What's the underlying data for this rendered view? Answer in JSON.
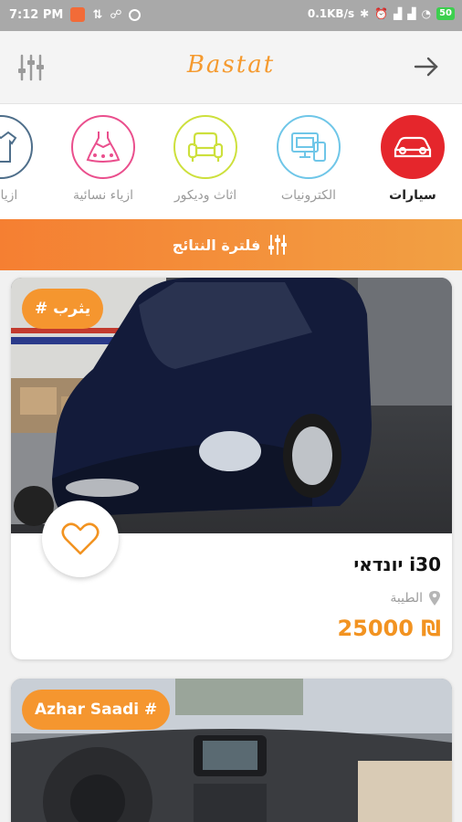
{
  "status_bar": {
    "time": "7:12 PM",
    "speed": "0.1KB/s",
    "battery": "50"
  },
  "app_bar": {
    "logo": "Bastat"
  },
  "categories": [
    {
      "label": "سيارات",
      "icon": "car-icon",
      "color": "#e5262c",
      "active": true
    },
    {
      "label": "الكترونيات",
      "icon": "electronics-icon",
      "color": "#6fc6e8",
      "active": false
    },
    {
      "label": "اثاث وديكور",
      "icon": "armchair-icon",
      "color": "#cde03c",
      "active": false
    },
    {
      "label": "ازياء نسائية",
      "icon": "dress-icon",
      "color": "#ea4f8d",
      "active": false
    },
    {
      "label": "ازياء ر",
      "icon": "shirt-icon",
      "color": "#4e6e8a",
      "active": false
    }
  ],
  "filter_banner": {
    "label": "فلترة النتائج"
  },
  "listings": [
    {
      "tag": "# يثرب",
      "title": "יונדאי i30",
      "location": "الطيبة",
      "price": "25000 ₪"
    },
    {
      "tag": "Azhar Saadi #"
    }
  ],
  "colors": {
    "accent": "#f5962f",
    "status_bar": "#a9a9a9"
  }
}
